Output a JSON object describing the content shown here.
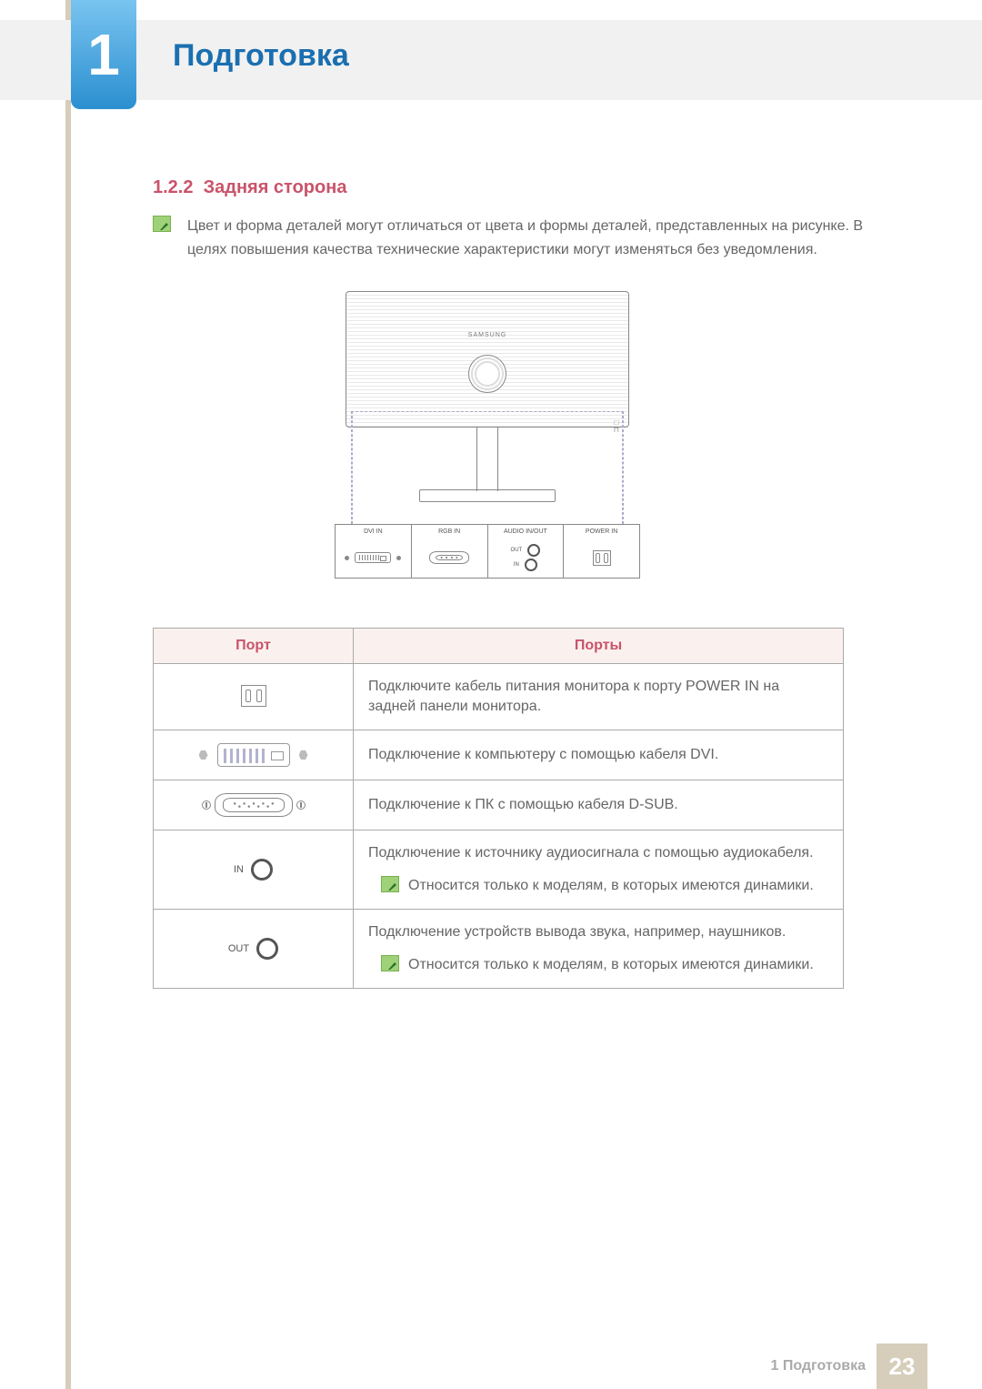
{
  "chapter": {
    "number": "1",
    "title": "Подготовка"
  },
  "section": {
    "number": "1.2.2",
    "title": "Задняя сторона"
  },
  "note": "Цвет и форма деталей могут отличаться от цвета и формы деталей, представленных на рисунке. В целях повышения качества технические характеристики могут изменяться без уведомления.",
  "diagram": {
    "brand": "SAMSUNG",
    "port_labels": {
      "dvi": "DVI IN",
      "rgb": "RGB IN",
      "audio": "AUDIO IN/OUT",
      "audio_out": "OUT",
      "audio_in": "IN",
      "power": "POWER IN"
    }
  },
  "table": {
    "headers": {
      "port": "Порт",
      "ports": "Порты"
    },
    "rows": [
      {
        "icon": "power",
        "desc": "Подключите кабель питания монитора к порту POWER IN на задней панели монитора."
      },
      {
        "icon": "dvi",
        "desc": "Подключение к компьютеру с помощью кабеля DVI."
      },
      {
        "icon": "dsub",
        "desc": "Подключение к ПК с помощью кабеля D-SUB."
      },
      {
        "icon": "audio-in",
        "label": "IN",
        "desc": "Подключение к источнику аудиосигнала с помощью аудиокабеля.",
        "note": "Относится только к моделям, в которых имеются динамики."
      },
      {
        "icon": "audio-out",
        "label": "OUT",
        "desc": "Подключение устройств вывода звука, например, наушников.",
        "note": "Относится только к моделям, в которых имеются динамики."
      }
    ]
  },
  "footer": {
    "text": "1 Подготовка",
    "page": "23"
  }
}
